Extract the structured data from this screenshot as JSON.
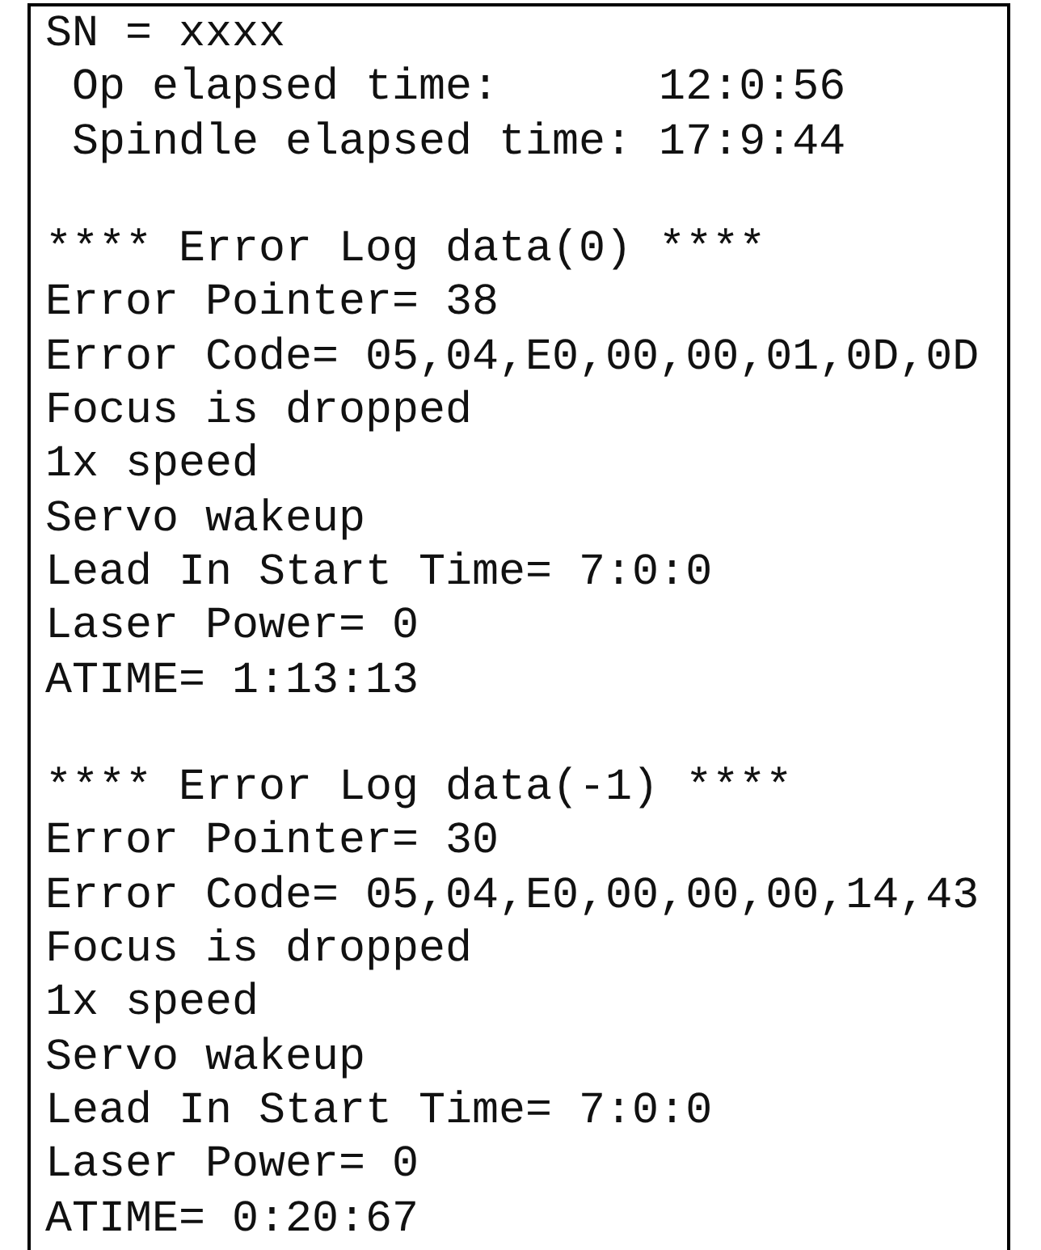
{
  "header": [
    "SN = xxxx",
    " Op elapsed time:      12:0:56",
    " Spindle elapsed time: 17:9:44"
  ],
  "error_logs": [
    {
      "title": "**** Error Log data(0) ****",
      "lines": [
        "Error Pointer= 38",
        "Error Code= 05,04,E0,00,00,01,0D,0D",
        "Focus is dropped",
        "1x speed",
        "Servo wakeup",
        "Lead In Start Time= 7:0:0",
        "Laser Power= 0",
        "ATIME= 1:13:13"
      ]
    },
    {
      "title": "**** Error Log data(-1) ****",
      "lines": [
        "Error Pointer= 30",
        "Error Code= 05,04,E0,00,00,00,14,43",
        "Focus is dropped",
        "1x speed",
        "Servo wakeup",
        "Lead In Start Time= 7:0:0",
        "Laser Power= 0",
        "ATIME= 0:20:67"
      ]
    }
  ]
}
